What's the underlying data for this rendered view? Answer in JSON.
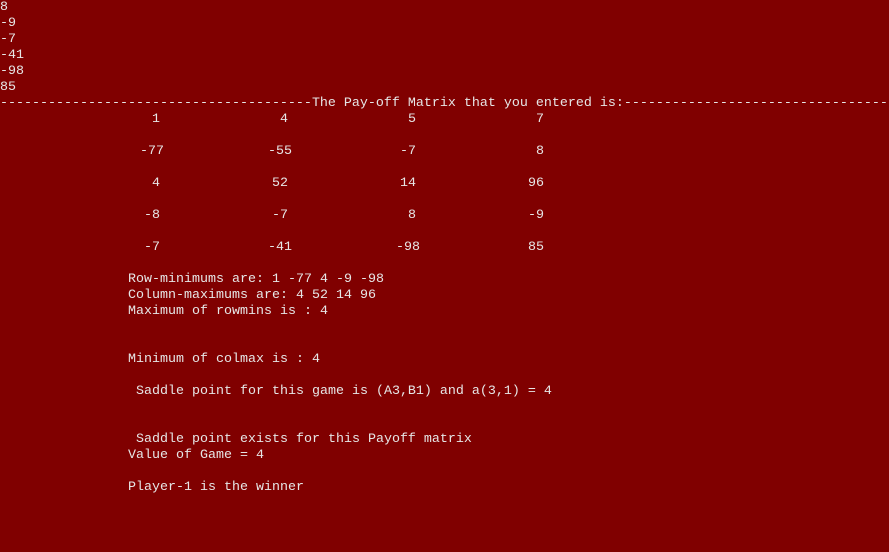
{
  "input_echo": [
    "8",
    "-9",
    "-7",
    "-41",
    "-98",
    "85"
  ],
  "header": {
    "left_rule": "---------------------------------------",
    "title": "The Pay-off Matrix that you entered is:",
    "right_rule": "---------------------------------"
  },
  "matrix": [
    [
      "1",
      "4",
      "5",
      "7"
    ],
    [
      "-77",
      "-55",
      "-7",
      "8"
    ],
    [
      "4",
      "52",
      "14",
      "96"
    ],
    [
      "-8",
      "-7",
      "8",
      "-9"
    ],
    [
      "-7",
      "-41",
      "-98",
      "85"
    ]
  ],
  "results": {
    "row_minimums": "Row-minimums are: 1 -77 4 -9 -98",
    "column_maximums": "Column-maximums are: 4 52 14 96",
    "max_rowmins": "Maximum of rowmins is : 4",
    "min_colmax": "Minimum of colmax is : 4",
    "saddle_point": " Saddle point for this game is (A3,B1) and a(3,1) = 4",
    "saddle_exists": " Saddle point exists for this Payoff matrix",
    "game_value": "Value of Game = 4",
    "winner": "Player-1 is the winner"
  }
}
